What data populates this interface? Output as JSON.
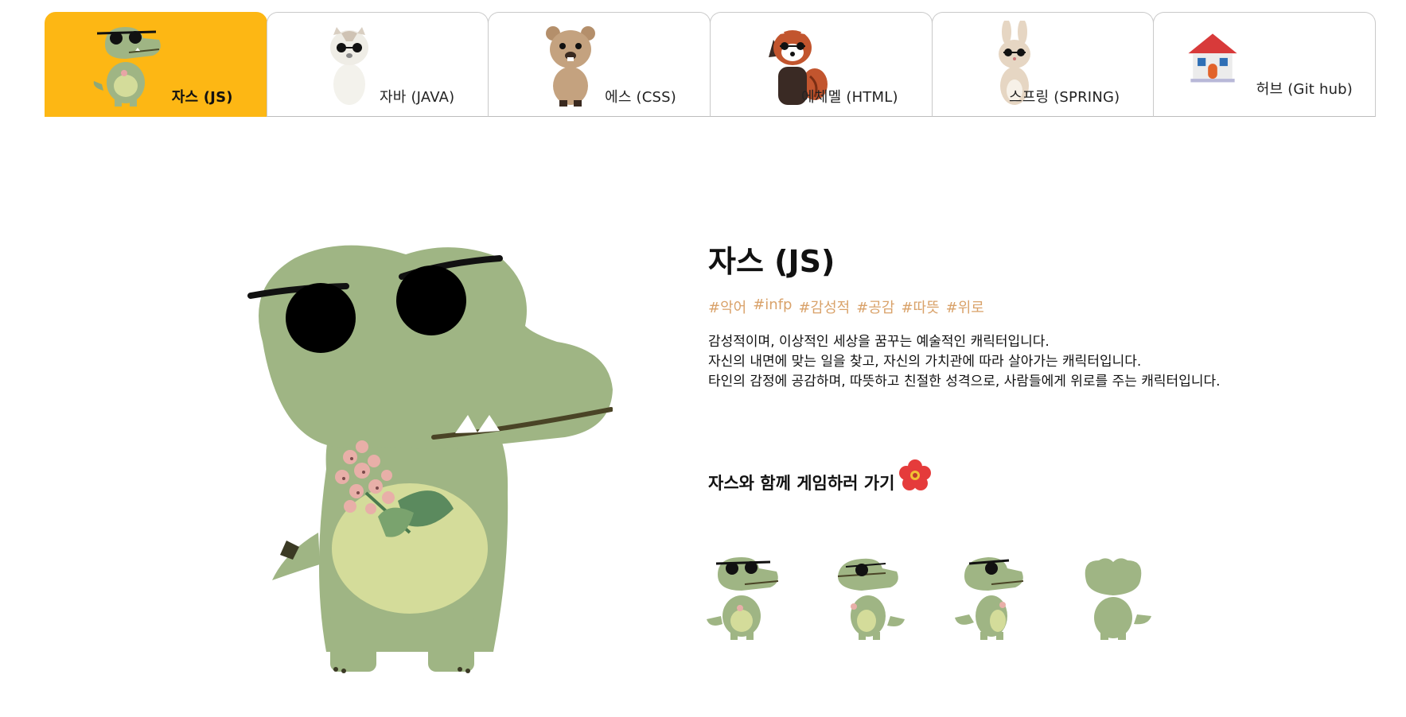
{
  "tabs": [
    {
      "label": "자스 (JS)",
      "icon": "crocodile-icon",
      "active": true
    },
    {
      "label": "자바 (JAVA)",
      "icon": "hamster-icon",
      "active": false
    },
    {
      "label": "에스 (CSS)",
      "icon": "quokka-icon",
      "active": false
    },
    {
      "label": "에체멜 (HTML)",
      "icon": "red-panda-icon",
      "active": false
    },
    {
      "label": "스프링 (SPRING)",
      "icon": "rabbit-icon",
      "active": false
    },
    {
      "label": "허브 (Git hub)",
      "icon": "house-icon",
      "active": false
    }
  ],
  "character": {
    "name": "자스 (JS)",
    "tags": [
      "#악어",
      "#infp",
      "#감성적",
      "#공감",
      "#따뜻",
      "#위로"
    ],
    "description": [
      "감성적이며, 이상적인 세상을 꿈꾸는 예술적인 캐릭터입니다.",
      "자신의 내면에 맞는 일을 찾고, 자신의 가치관에 따라 살아가는 캐릭터입니다.",
      "타인의 감정에 공감하며, 따뜻하고 친절한 성격으로, 사람들에게 위로를 주는 캐릭터입니다."
    ],
    "cta_label": "자스와 함께 게임하러 가기",
    "cta_icon": "hibiscus-icon",
    "game_poses": [
      "crocodile-front-icon",
      "crocodile-eyepatch-icon",
      "crocodile-side-icon",
      "crocodile-back-icon"
    ]
  },
  "colors": {
    "active_tab": "#FDB714",
    "tag": "#D9A26A",
    "croc_body": "#9FB584",
    "croc_belly": "#D4DC9A"
  }
}
